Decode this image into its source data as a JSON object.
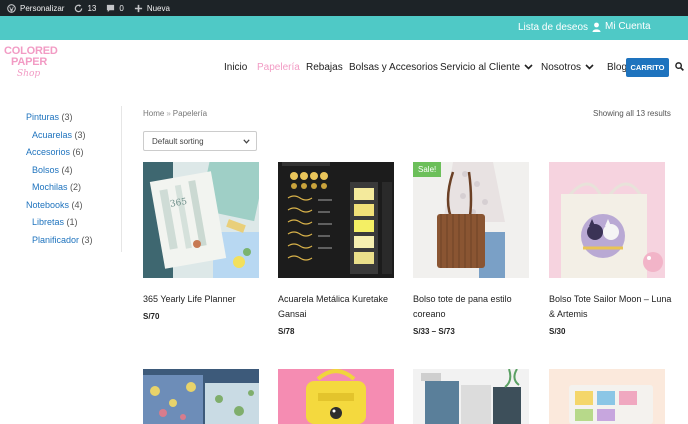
{
  "adminbar": {
    "site": "Personalizar",
    "updates": "13",
    "comments": "0",
    "new": "Nueva"
  },
  "topbar": {
    "wishlist": "Lista de deseos",
    "account": "Mi Cuenta",
    "color": "#4fc9c6"
  },
  "logo": {
    "line1": "COLORED",
    "line2": "PAPER",
    "line3": "Shop"
  },
  "nav": {
    "items": [
      "Inicio",
      "Papelería",
      "Rebajas",
      "Bolsas y Accesorios",
      "Servicio al Cliente",
      "Nosotros",
      "Blog"
    ],
    "active": "Papelería",
    "cart": "CARRITO"
  },
  "sidebar": {
    "categories": [
      {
        "name": "Pinturas",
        "count": "(3)",
        "level": 0
      },
      {
        "name": "Acuarelas",
        "count": "(3)",
        "level": 1
      },
      {
        "name": "Accesorios",
        "count": "(6)",
        "level": 0
      },
      {
        "name": "Bolsos",
        "count": "(4)",
        "level": 1
      },
      {
        "name": "Mochilas",
        "count": "(2)",
        "level": 1
      },
      {
        "name": "Notebooks",
        "count": "(4)",
        "level": 0
      },
      {
        "name": "Libretas",
        "count": "(1)",
        "level": 1
      },
      {
        "name": "Planificador",
        "count": "(3)",
        "level": 1
      }
    ]
  },
  "shop": {
    "breadcrumb_home": "Home",
    "breadcrumb_sep": "»",
    "breadcrumb_current": "Papelería",
    "result_count": "Showing all 13 results",
    "sorting": "Default sorting"
  },
  "products": [
    {
      "title": "365 Yearly Life Planner",
      "price": "S/70",
      "sale": ""
    },
    {
      "title": "Acuarela Metálica Kuretake Gansai",
      "price": "S/78",
      "sale": ""
    },
    {
      "title": "Bolso tote de pana estilo coreano",
      "price": "S/33 – S/73",
      "sale": "Sale!"
    },
    {
      "title": "Bolso Tote Sailor Moon – Luna & Artemis",
      "price": "S/30",
      "sale": ""
    }
  ],
  "colors": {
    "accent": "#f29bc4",
    "link": "#1e73be",
    "sale": "#6cbf5a"
  }
}
